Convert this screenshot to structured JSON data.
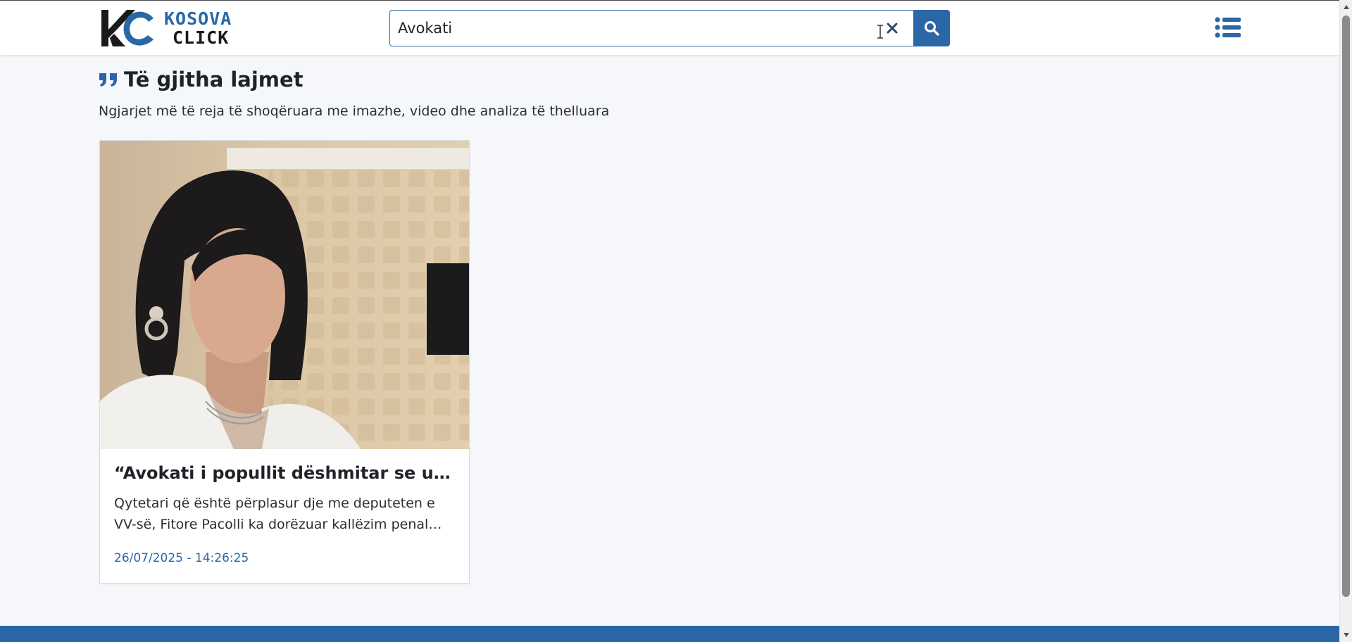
{
  "header": {
    "logo": {
      "line1": "KOSOVA",
      "line2": "CLICK"
    },
    "search": {
      "value": "Avokati",
      "placeholder": ""
    },
    "icons": {
      "clear": "close-icon",
      "search": "search-icon",
      "menu": "list-menu-icon"
    }
  },
  "section": {
    "icon": "quote-icon",
    "title": "Të gjitha lajmet",
    "subtitle": "Ngjarjet më të reja të shoqëruara me imazhe, video dhe analiza të thelluara"
  },
  "articles": [
    {
      "title": "“Avokati i popullit dëshmitar se u sulm...",
      "excerpt": "Qytetari që është përplasur dje me deputeten e VV-së, Fitore Pacolli ka dorëzuar kallëzim penal ndaj...",
      "date": "26/07/2025 - 14:26:25"
    }
  ],
  "colors": {
    "accent": "#2b67a6",
    "background": "#f5f7fa",
    "text": "#1f2328"
  }
}
